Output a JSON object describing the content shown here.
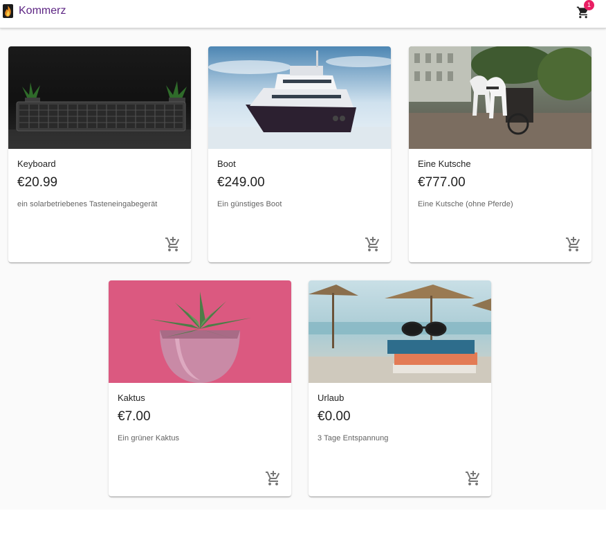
{
  "header": {
    "brand_name": "Kommerz",
    "cart_count": "1"
  },
  "icons": {
    "logo": "flame-logo-icon",
    "cart": "shopping-cart-icon",
    "add_to_cart": "add-shopping-cart-icon"
  },
  "colors": {
    "brand": "#5c2483",
    "badge": "#e91e63",
    "page_background": "#fafafa"
  },
  "products": [
    {
      "name": "Keyboard",
      "price": "€20.99",
      "description": "ein solarbetriebenes Tasteneingabegerät",
      "image": "keyboard-image"
    },
    {
      "name": "Boot",
      "price": "€249.00",
      "description": "Ein günstiges Boot",
      "image": "boat-image"
    },
    {
      "name": "Eine Kutsche",
      "price": "€777.00",
      "description": "Eine Kutsche (ohne Pferde)",
      "image": "carriage-image"
    },
    {
      "name": "Kaktus",
      "price": "€7.00",
      "description": "Ein grüner Kaktus",
      "image": "cactus-image"
    },
    {
      "name": "Urlaub",
      "price": "€0.00",
      "description": "3 Tage Entspannung",
      "image": "vacation-image"
    }
  ]
}
